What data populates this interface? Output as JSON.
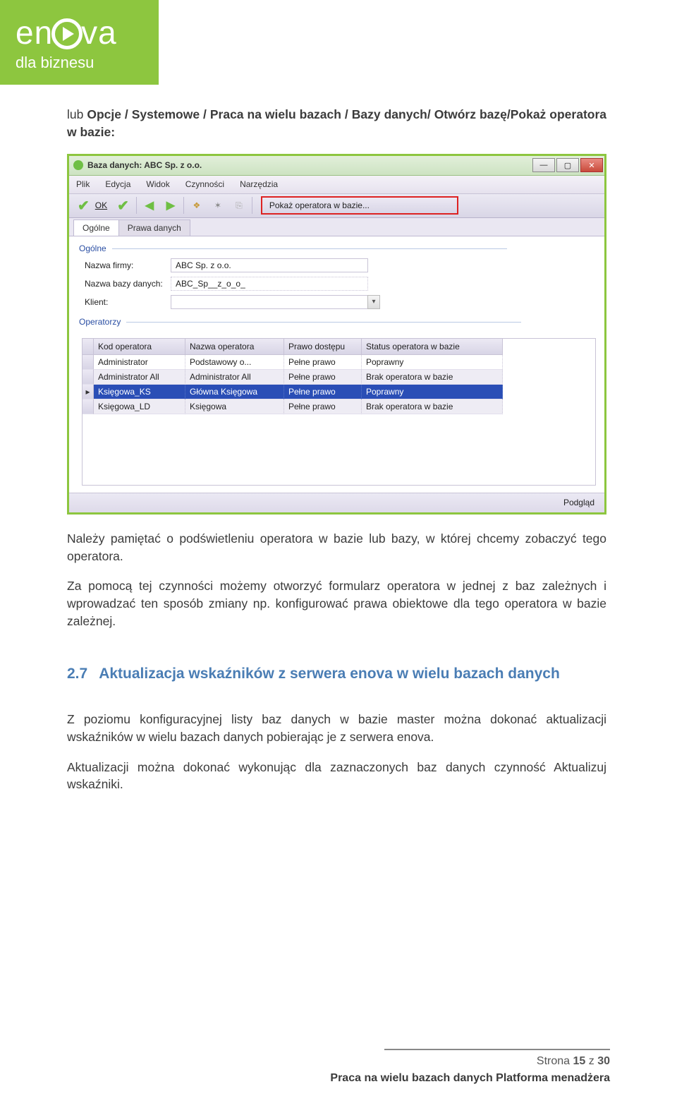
{
  "logo": {
    "word_a": "en",
    "word_b": "va",
    "subtitle": "dla biznesu"
  },
  "intro": {
    "prefix": "lub ",
    "bold_path": "Opcje / Systemowe / Praca na wielu bazach / Bazy danych/ Otwórz bazę/Pokaż operatora w bazie:"
  },
  "shot": {
    "title": "Baza danych: ABC Sp. z o.o.",
    "menu": [
      "Plik",
      "Edycja",
      "Widok",
      "Czynności",
      "Narzędzia"
    ],
    "ok_label": "OK",
    "redbox_text": "Pokaż operatora w bazie...",
    "tabs": [
      "Ogólne",
      "Prawa danych"
    ],
    "group_general": "Ogólne",
    "fields": {
      "firm_label": "Nazwa firmy:",
      "firm_value": "ABC Sp. z o.o.",
      "db_label": "Nazwa bazy danych:",
      "db_value": "ABC_Sp__z_o_o_",
      "client_label": "Klient:",
      "client_value": ""
    },
    "group_ops": "Operatorzy",
    "ops_head": [
      "Kod operatora",
      "Nazwa operatora",
      "Prawo dostępu",
      "Status operatora w bazie"
    ],
    "ops_rows": [
      {
        "mark": "",
        "cols": [
          "Administrator",
          "Podstawowy o...",
          "Pełne prawo",
          "Poprawny"
        ],
        "alt": false,
        "selected": false
      },
      {
        "mark": "",
        "cols": [
          "Administrator All",
          "Administrator All",
          "Pełne prawo",
          "Brak operatora w bazie"
        ],
        "alt": true,
        "selected": false
      },
      {
        "mark": "▸",
        "cols": [
          "Księgowa_KS",
          "Główna Księgowa",
          "Pełne prawo",
          "Poprawny"
        ],
        "alt": false,
        "selected": true
      },
      {
        "mark": "",
        "cols": [
          "Księgowa_LD",
          "Księgowa",
          "Pełne prawo",
          "Brak operatora w bazie"
        ],
        "alt": true,
        "selected": false
      }
    ],
    "footer_btn": "Podgląd"
  },
  "para1": "Należy pamiętać o podświetleniu operatora w bazie lub bazy, w której chcemy zobaczyć tego operatora.",
  "para2": "Za pomocą tej czynności możemy otworzyć  formularz operatora w jednej z baz zależnych i wprowadzać ten sposób zmiany np. konfigurować prawa obiektowe dla tego operatora w bazie zależnej.",
  "heading": {
    "num": "2.7",
    "text": "Aktualizacja wskaźników z serwera enova w wielu bazach danych"
  },
  "para3": "Z poziomu konfiguracyjnej listy baz danych w bazie master można dokonać aktualizacji wskaźników w wielu bazach danych pobierając je z serwera enova.",
  "para4": "Aktualizacji można dokonać wykonując dla zaznaczonych baz danych czynność Aktualizuj wskaźniki.",
  "footer": {
    "page_prefix": "Strona ",
    "page_cur": "15",
    "page_mid": " z ",
    "page_total": "30",
    "doc_title": "Praca na wielu bazach danych Platforma menadżera"
  }
}
